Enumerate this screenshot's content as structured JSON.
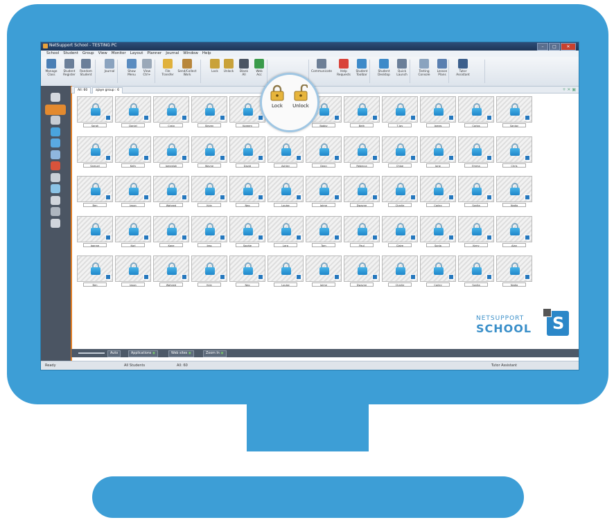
{
  "window": {
    "title": "NetSupport School - TESTING PC"
  },
  "menu": [
    "School",
    "Student",
    "Group",
    "View",
    "Monitor",
    "Layout",
    "Planner",
    "Journal",
    "Window",
    "Help"
  ],
  "toolbar": [
    {
      "label": "Manage\nClass",
      "icon": "manage-class-icon",
      "color": "#4a7fb5"
    },
    {
      "label": "Student\nRegister",
      "icon": "register-icon",
      "color": "#6b7f99"
    },
    {
      "label": "Random\nStudent",
      "icon": "random-icon",
      "color": "#6b7f99"
    },
    {
      "label": "Journal",
      "icon": "journal-icon",
      "color": "#8aa3bf"
    },
    {
      "label": "Show\nMenu",
      "icon": "show-icon",
      "color": "#5a8cc0"
    },
    {
      "label": "View\nCtrl+",
      "icon": "view-icon",
      "color": "#9aa8b8"
    },
    {
      "label": "File\nTransfer",
      "icon": "file-transfer-icon",
      "color": "#e0b13c"
    },
    {
      "label": "Send/Collect\nWork",
      "icon": "send-collect-icon",
      "color": "#b8863b"
    },
    {
      "label": "Lock",
      "icon": "lock-icon",
      "color": "#c9a23a"
    },
    {
      "label": "Unlock",
      "icon": "unlock-icon",
      "color": "#c9a23a"
    },
    {
      "label": "Blank\nAll",
      "icon": "blank-icon",
      "color": "#4b5563"
    },
    {
      "label": "Web\nAcc",
      "icon": "web-icon",
      "color": "#3a9b4b"
    },
    {
      "label": "Communicate",
      "icon": "communicate-icon",
      "color": "#6d7f96"
    },
    {
      "label": "Help\nRequests",
      "icon": "help-requests-icon",
      "color": "#d9433a"
    },
    {
      "label": "Student\nToolbar",
      "icon": "student-toolbar-icon",
      "color": "#3d8ac9"
    },
    {
      "label": "Student\nDesktop",
      "icon": "desktop-icon",
      "color": "#3d8ac9"
    },
    {
      "label": "Quick\nLaunch",
      "icon": "launch-icon",
      "color": "#6b7f99"
    },
    {
      "label": "Testing\nConsole",
      "icon": "testing-icon",
      "color": "#8aa3bf"
    },
    {
      "label": "Lesson\nPlans",
      "icon": "lesson-plans-icon",
      "color": "#5a7fb0"
    },
    {
      "label": "Tutor\nAssistant",
      "icon": "tutor-assistant-icon",
      "color": "#3c5f8c"
    }
  ],
  "zoom": {
    "lock": "Lock",
    "unlock": "Unlock"
  },
  "tabs": [
    "All: 60",
    "ajaye group : 6"
  ],
  "students": [
    [
      "Sarah",
      "Daniel",
      "Craig",
      "Steven",
      "Kareem",
      "Leon",
      "Bobby",
      "Beth",
      "T-Jay",
      "James",
      "Carlos",
      "Sanjay"
    ],
    [
      "Samuel",
      "Kelly",
      "Jameelah",
      "Wayne",
      "David",
      "Ashley",
      "Dean",
      "Rebecca",
      "Chloe",
      "Jane",
      "Emma",
      "Chris"
    ],
    [
      "Ben",
      "Jason",
      "Waheed",
      "Kyle",
      "Neo",
      "Louise",
      "Jaime",
      "Dwayne",
      "Charlie",
      "Carley",
      "Sonita",
      "Nadia"
    ],
    [
      "Joanne",
      "Karl",
      "Kane",
      "Jess",
      "Sophie",
      "Lara",
      "Tom",
      "Paul",
      "Claire",
      "Sonia",
      "Kerry",
      "Alan"
    ],
    [
      "Ben",
      "Jason",
      "Waheed",
      "Kyle",
      "Neo",
      "Louise",
      "Jaime",
      "Dwayne",
      "Charlie",
      "Carley",
      "Sonita",
      "Nadia"
    ]
  ],
  "bottom_toolbar": {
    "auto": "Auto",
    "applications": "Applications",
    "websites": "Web sites",
    "zoom_in": "Zoom In"
  },
  "status": {
    "ready": "Ready",
    "students": "All Students",
    "count": "All: 60",
    "tutor": "Tutor Assistant"
  },
  "logo": {
    "line1": "NETSUPPORT",
    "line2": "SCHOOL",
    "mark": "S"
  },
  "colors": {
    "monitor": "#3d9ed6",
    "sidebar": "#4b5563",
    "accent": "#e07b22",
    "lock": "#1f86c9"
  }
}
